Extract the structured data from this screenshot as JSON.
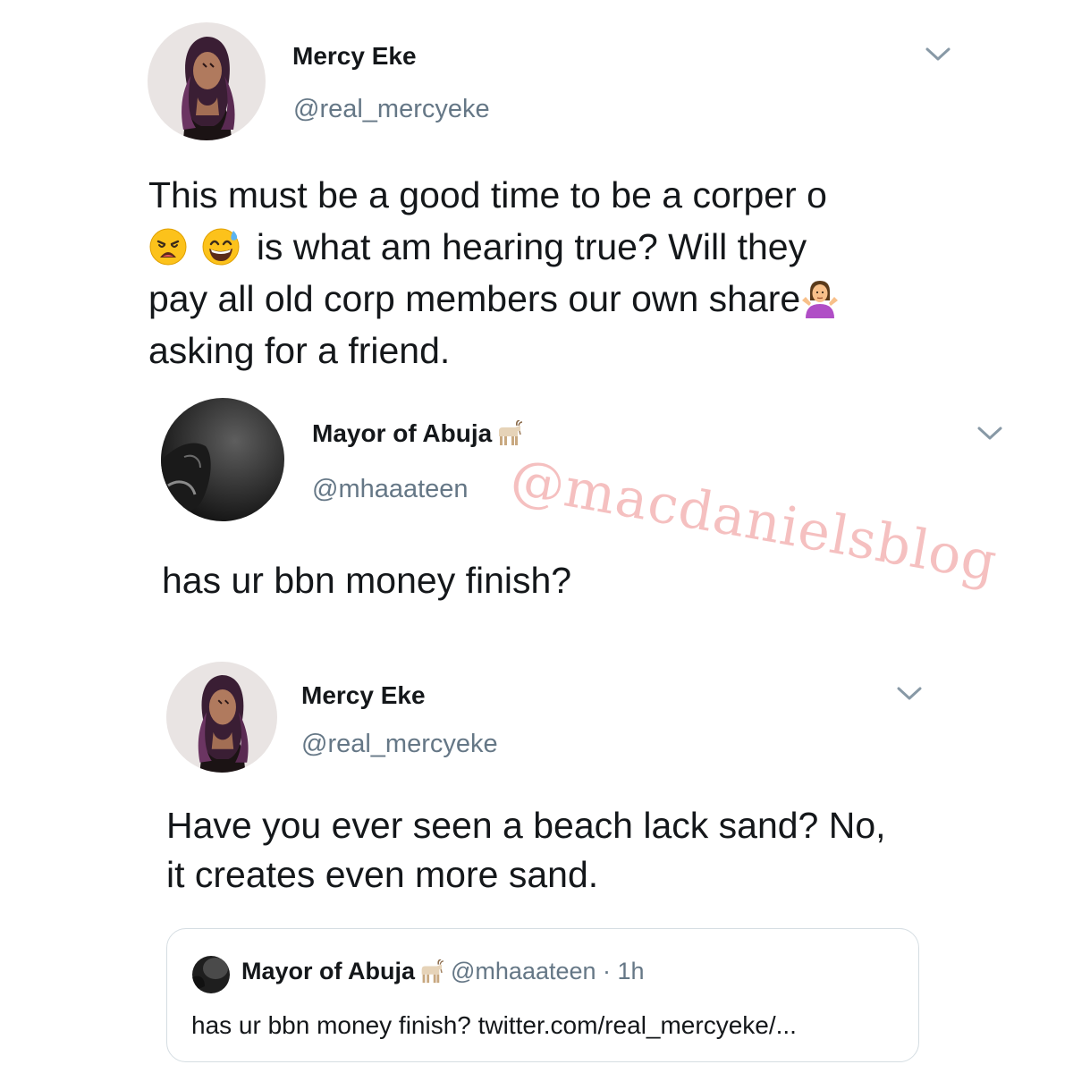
{
  "tweets": [
    {
      "name": "Mercy Eke",
      "handle": "@real_mercyeke",
      "lines": [
        "This must be a good time to be a corper o",
        "is what am hearing true? Will they",
        "pay all old corp members our own share",
        "asking for a friend."
      ],
      "emojis": [
        "weary-face-emoji",
        "grinning-sweat-emoji",
        "person-shrugging-emoji"
      ]
    },
    {
      "name": "Mayor of Abuja",
      "name_emoji": "goat-emoji",
      "handle": "@mhaaateen",
      "text": "has ur bbn money finish?"
    },
    {
      "name": "Mercy Eke",
      "handle": "@real_mercyeke",
      "lines": [
        "Have you ever seen a beach lack sand? No,",
        "it creates even more sand."
      ]
    }
  ],
  "quoted_tweet": {
    "name": "Mayor of Abuja",
    "name_emoji": "goat-emoji",
    "handle_time": "@mhaaateen · 1h",
    "text": "has ur bbn money finish? twitter.com/real_mercyeke/..."
  },
  "watermark": "@macdanielsblog",
  "icons": {
    "more_menu": "chevron-down-icon"
  },
  "colors": {
    "text_primary": "#14171a",
    "text_secondary": "#657786",
    "card_border": "#d5dde2",
    "watermark": "#ec8c8c"
  }
}
